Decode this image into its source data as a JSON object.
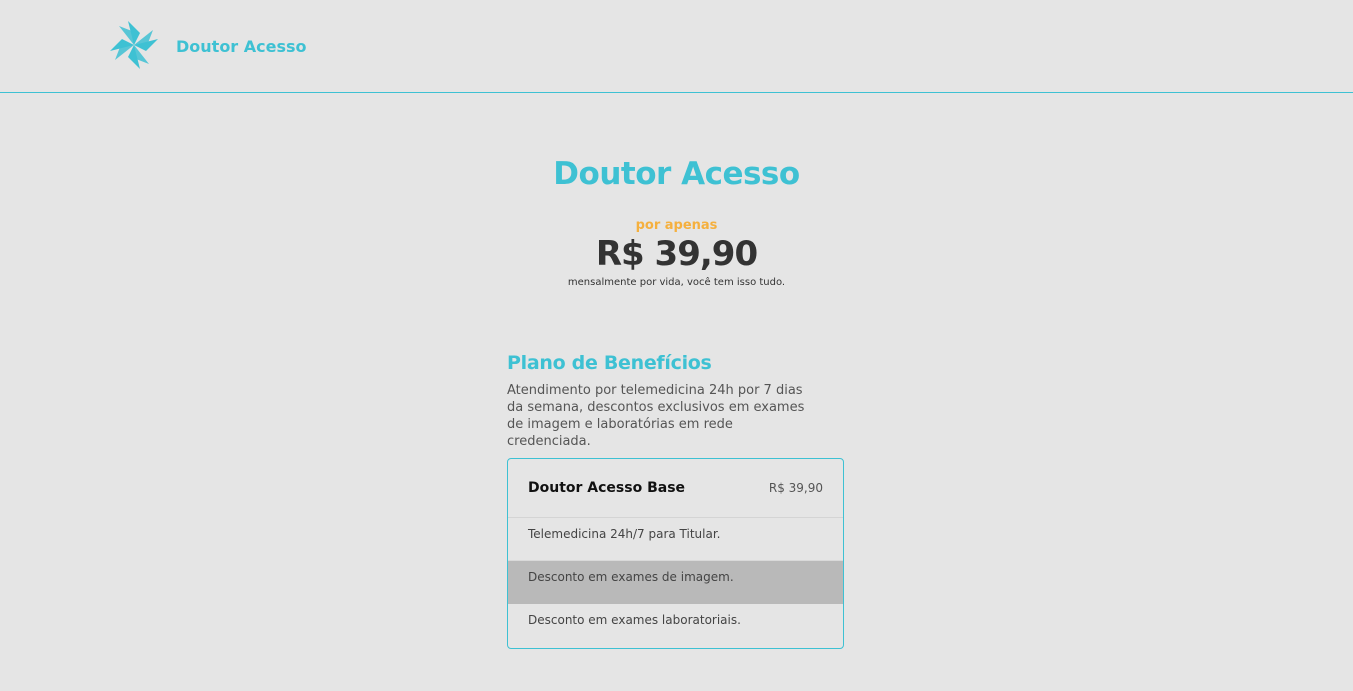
{
  "brand": {
    "name": "Doutor Acesso",
    "accent_color": "#3ec1d3",
    "logo_icon": "pinwheel-logo-icon"
  },
  "hero": {
    "title": "Doutor Acesso",
    "subtitle": "por apenas",
    "price": "R$ 39,90",
    "note": "mensalmente por vida, você tem isso tudo.",
    "subtitle_color": "#f5b03e"
  },
  "benefits": {
    "title": "Plano de Benefícios",
    "description": "Atendimento por telemedicina 24h por 7 dias da semana, descontos exclusivos em exames de imagem e laboratórias em rede credenciada."
  },
  "plan": {
    "name": "Doutor Acesso Base",
    "price": "R$ 39,90",
    "items": [
      "Telemedicina 24h/7 para Titular.",
      "Desconto em exames de imagem.",
      "Desconto em exames laboratoriais."
    ]
  }
}
